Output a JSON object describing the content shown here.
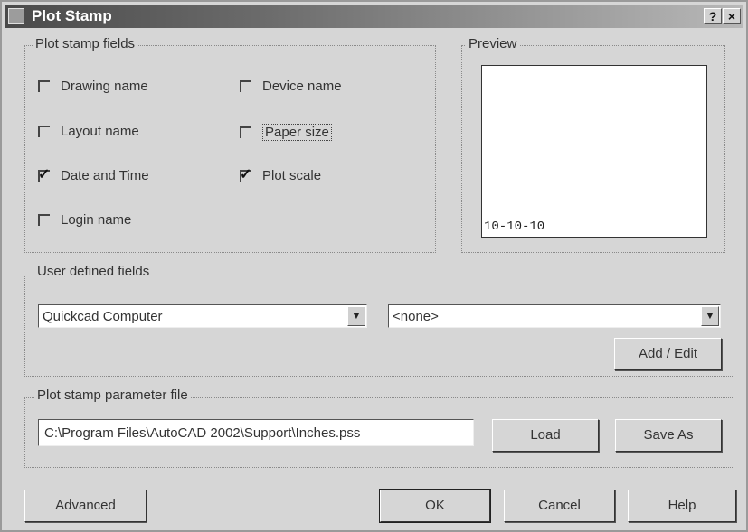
{
  "window": {
    "title": "Plot Stamp",
    "help": "?",
    "close": "×"
  },
  "fields_group": {
    "label": "Plot stamp fields",
    "items": [
      {
        "label": "Drawing name",
        "checked": false
      },
      {
        "label": "Device name",
        "checked": false
      },
      {
        "label": "Layout name",
        "checked": false
      },
      {
        "label": "Paper size",
        "checked": false
      },
      {
        "label": "Date and Time",
        "checked": true
      },
      {
        "label": "Plot scale",
        "checked": true
      },
      {
        "label": "Login name",
        "checked": false
      }
    ]
  },
  "preview": {
    "label": "Preview",
    "text": "10-10-10"
  },
  "user_fields": {
    "label": "User defined fields",
    "combo1": "Quickcad Computer",
    "combo2": "<none>",
    "add_edit": "Add / Edit",
    "arrow": "▼"
  },
  "param_file": {
    "label": "Plot stamp parameter file",
    "path": "C:\\Program Files\\AutoCAD 2002\\Support\\Inches.pss",
    "load": "Load",
    "save_as": "Save As"
  },
  "buttons": {
    "advanced": "Advanced",
    "ok": "OK",
    "cancel": "Cancel",
    "help": "Help"
  },
  "checkmark": "✓"
}
